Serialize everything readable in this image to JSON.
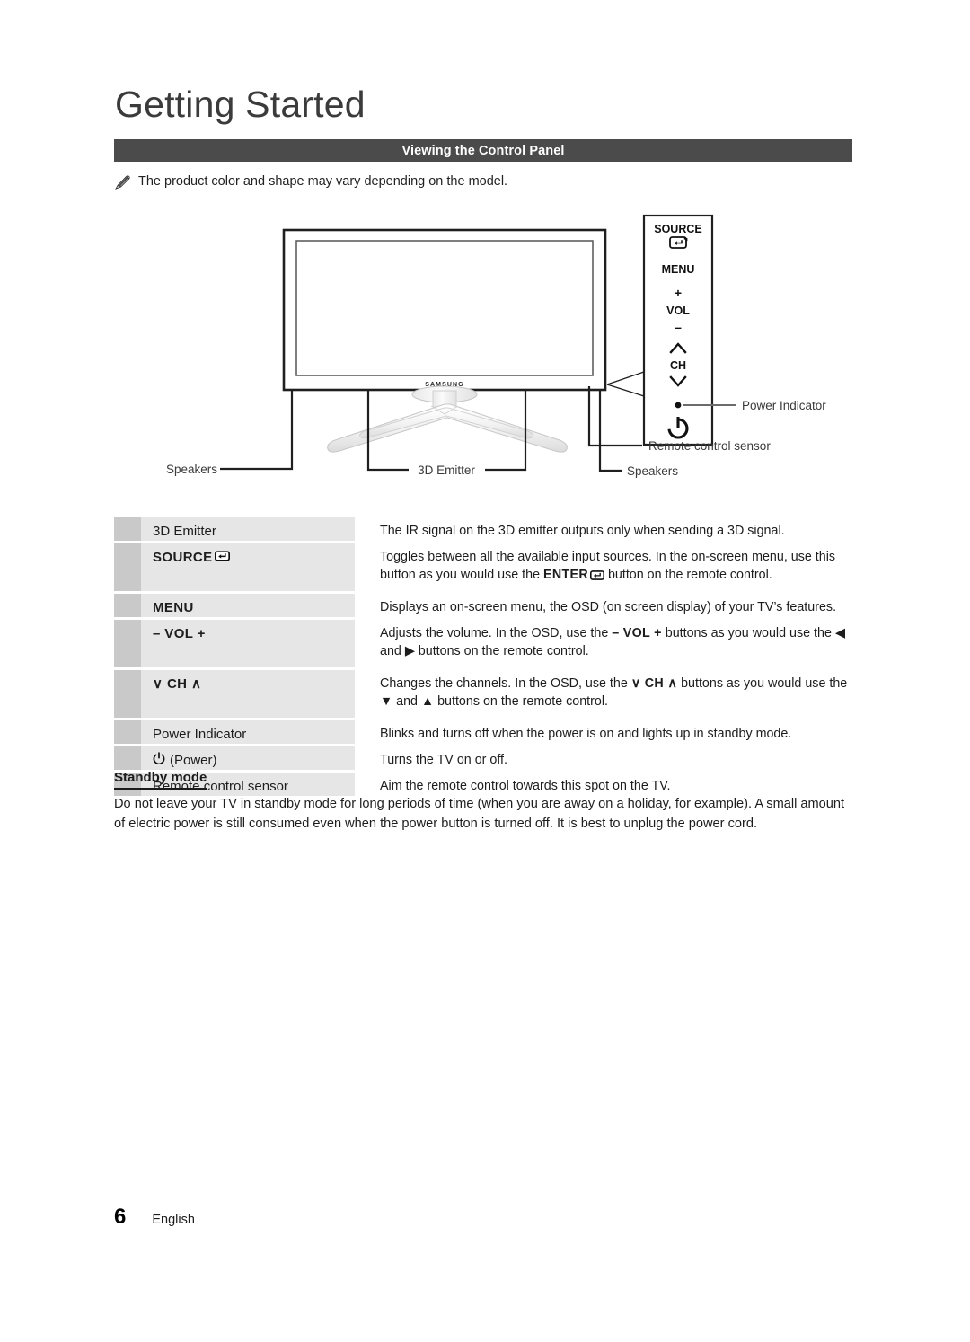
{
  "header": {
    "page_title": "Getting Started",
    "section_bar_label": "Viewing the Control Panel",
    "note_icon": "pencil-note-icon",
    "note_text": "The product color and shape may vary depending on the model."
  },
  "diagram": {
    "brand_logo": "SAMSUNG",
    "callouts": {
      "speakers_left": "Speakers",
      "speakers_right": "Speakers",
      "emitter": "3D Emitter",
      "power_indicator": "Power Indicator",
      "remote_sensor": "Remote control sensor"
    },
    "control_panel_buttons": {
      "source": "SOURCE",
      "source_icon": "enter-return-icon",
      "menu": "MENU",
      "vol_plus": "+",
      "vol": "VOL",
      "vol_minus": "–",
      "ch_up_icon": "chevron-up-icon",
      "ch": "CH",
      "ch_down_icon": "chevron-down-icon",
      "power_led_icon": "power-led-dot-icon",
      "power_icon": "power-button-icon"
    }
  },
  "spec_table": {
    "rows": [
      {
        "label": "3D Emitter",
        "label_style": "plain",
        "desc": "The IR signal on the 3D emitter outputs only when sending a 3D signal.",
        "lines": 1
      },
      {
        "label": "SOURCE",
        "label_style": "bold-source",
        "desc_part1": "Toggles between all the available input sources. In the on-screen menu, use this button as you would use the ",
        "desc_inline": "ENTER",
        "desc_part2": " button on the remote control.",
        "lines": 2
      },
      {
        "label": "MENU",
        "label_style": "bold",
        "desc": "Displays an on-screen menu, the OSD (on screen display) of your TV’s features.",
        "lines": 1
      },
      {
        "label": "– VOL +",
        "label_style": "bold",
        "desc_part1": "Adjusts the volume. In the OSD, use the ",
        "desc_inline": "– VOL +",
        "desc_part2": " buttons as you would use the ◀ and ▶ buttons on the remote control.",
        "lines": 2
      },
      {
        "label": "∨ CH ∧",
        "label_style": "bold",
        "desc_part1": "Changes the channels. In the OSD, use the ",
        "desc_inline": "∨ CH ∧",
        "desc_part2": " buttons as you would use the ▼ and ▲ buttons on the remote control.",
        "lines": 2
      },
      {
        "label": "Power Indicator",
        "label_style": "plain",
        "desc": "Blinks and turns off when the power is on and lights up in standby mode.",
        "lines": 1
      },
      {
        "label": "(Power)",
        "label_style": "power",
        "desc": "Turns the TV on or off.",
        "lines": 1
      },
      {
        "label": "Remote control sensor",
        "label_style": "plain",
        "desc": "Aim the remote control towards this spot on the TV.",
        "lines": 1
      }
    ]
  },
  "standby": {
    "heading": "Standby mode",
    "body": "Do not leave your TV in standby mode for long periods of time (when you are away on a holiday, for example). A small amount of electric power is still consumed even when the power button is turned off. It is best to unplug the power cord."
  },
  "footer": {
    "page_number": "6",
    "language": "English"
  },
  "colors": {
    "section_bar": "#4b4b4b",
    "row_marker": "#c9c9c9",
    "row_label": "#e6e6e6",
    "text": "#1d1d1d"
  }
}
